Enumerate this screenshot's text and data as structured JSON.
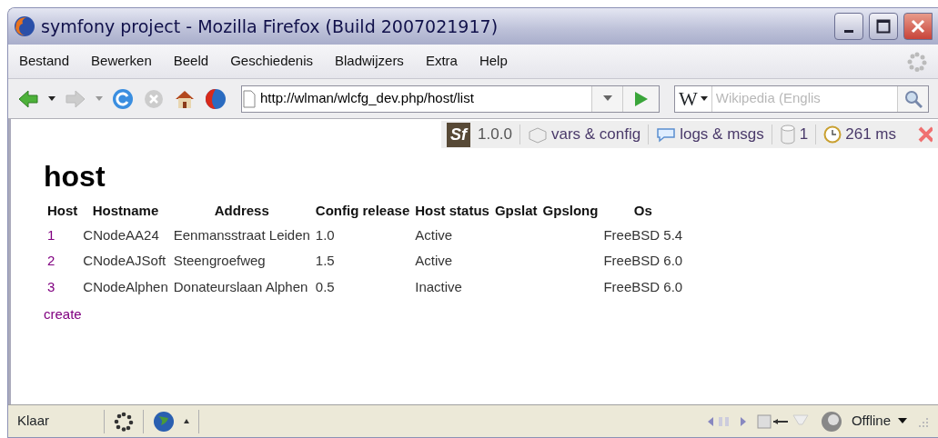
{
  "window": {
    "title": "symfony project - Mozilla Firefox (Build 2007021917)"
  },
  "menu": [
    {
      "label": "Bestand"
    },
    {
      "label": "Bewerken"
    },
    {
      "label": "Beeld"
    },
    {
      "label": "Geschiedenis"
    },
    {
      "label": "Bladwijzers"
    },
    {
      "label": "Extra"
    },
    {
      "label": "Help"
    }
  ],
  "toolbar": {
    "back_disabled": false,
    "forward_disabled": true,
    "stop_disabled": true,
    "address": "http://wlman/wlcfg_dev.php/host/list",
    "search_engine": "W",
    "search_placeholder": "Wikipedia (Englis"
  },
  "debug_bar": {
    "logo": "Sf",
    "version": "1.0.0",
    "vars": "vars & config",
    "logs": "logs & msgs",
    "queries": "1",
    "time": "261 ms"
  },
  "page": {
    "heading": "host",
    "table": {
      "columns": [
        "Host",
        "Hostname",
        "Address",
        "Config release",
        "Host status",
        "Gpslat",
        "Gpslong",
        "Os"
      ],
      "rows": [
        [
          "1",
          "CNodeAA24",
          "Eenmansstraat Leiden",
          "1.0",
          "Active",
          null,
          null,
          "FreeBSD 5.4"
        ],
        [
          "2",
          "CNodeAJSoft",
          "Steengroefweg",
          "1.5",
          "Active",
          null,
          null,
          "FreeBSD 6.0"
        ],
        [
          "3",
          "CNodeAlphen",
          "Donateurslaan Alphen",
          "0.5",
          "Inactive",
          null,
          null,
          "FreeBSD 6.0"
        ]
      ]
    },
    "create_link": "create"
  },
  "status_bar": {
    "text": "Klaar",
    "offline": "Offline"
  }
}
